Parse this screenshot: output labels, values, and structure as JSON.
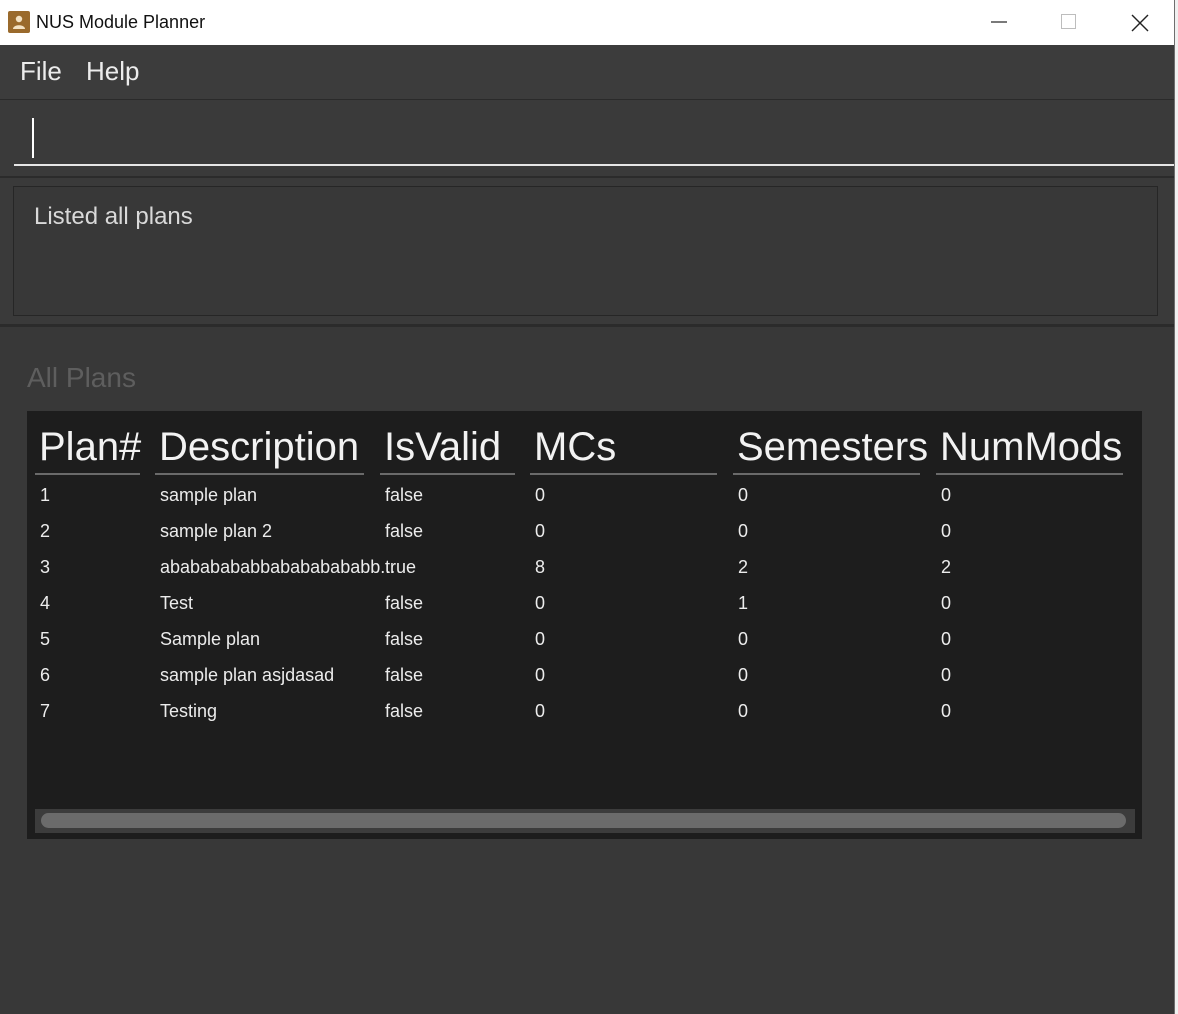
{
  "window": {
    "title": "NUS Module Planner"
  },
  "menu": {
    "file": "File",
    "help": "Help"
  },
  "command_box": {
    "value": "",
    "placeholder": ""
  },
  "result_display": {
    "text": "Listed all plans"
  },
  "plan_list": {
    "title": "All Plans",
    "columns": [
      "Plan#",
      "Description",
      "IsValid",
      "MCs",
      "Semesters",
      "NumMods"
    ],
    "rows": [
      [
        "1",
        "sample plan",
        "false",
        "0",
        "0",
        "0"
      ],
      [
        "2",
        "sample plan 2",
        "false",
        "0",
        "0",
        "0"
      ],
      [
        "3",
        "abababababbabababababb...",
        "true",
        "8",
        "2",
        "2"
      ],
      [
        "4",
        "Test",
        "false",
        "0",
        "1",
        "0"
      ],
      [
        "5",
        "Sample plan",
        "false",
        "0",
        "0",
        "0"
      ],
      [
        "6",
        "sample plan asjdasad",
        "false",
        "0",
        "0",
        "0"
      ],
      [
        "7",
        "Testing",
        "false",
        "0",
        "0",
        "0"
      ]
    ]
  },
  "icons": {
    "app": "app-person-icon",
    "minimize": "minimize-icon",
    "maximize": "maximize-icon",
    "close": "close-icon"
  },
  "colors": {
    "background": "#383838",
    "table_background": "#1d1d1d",
    "text": "#ececec"
  }
}
